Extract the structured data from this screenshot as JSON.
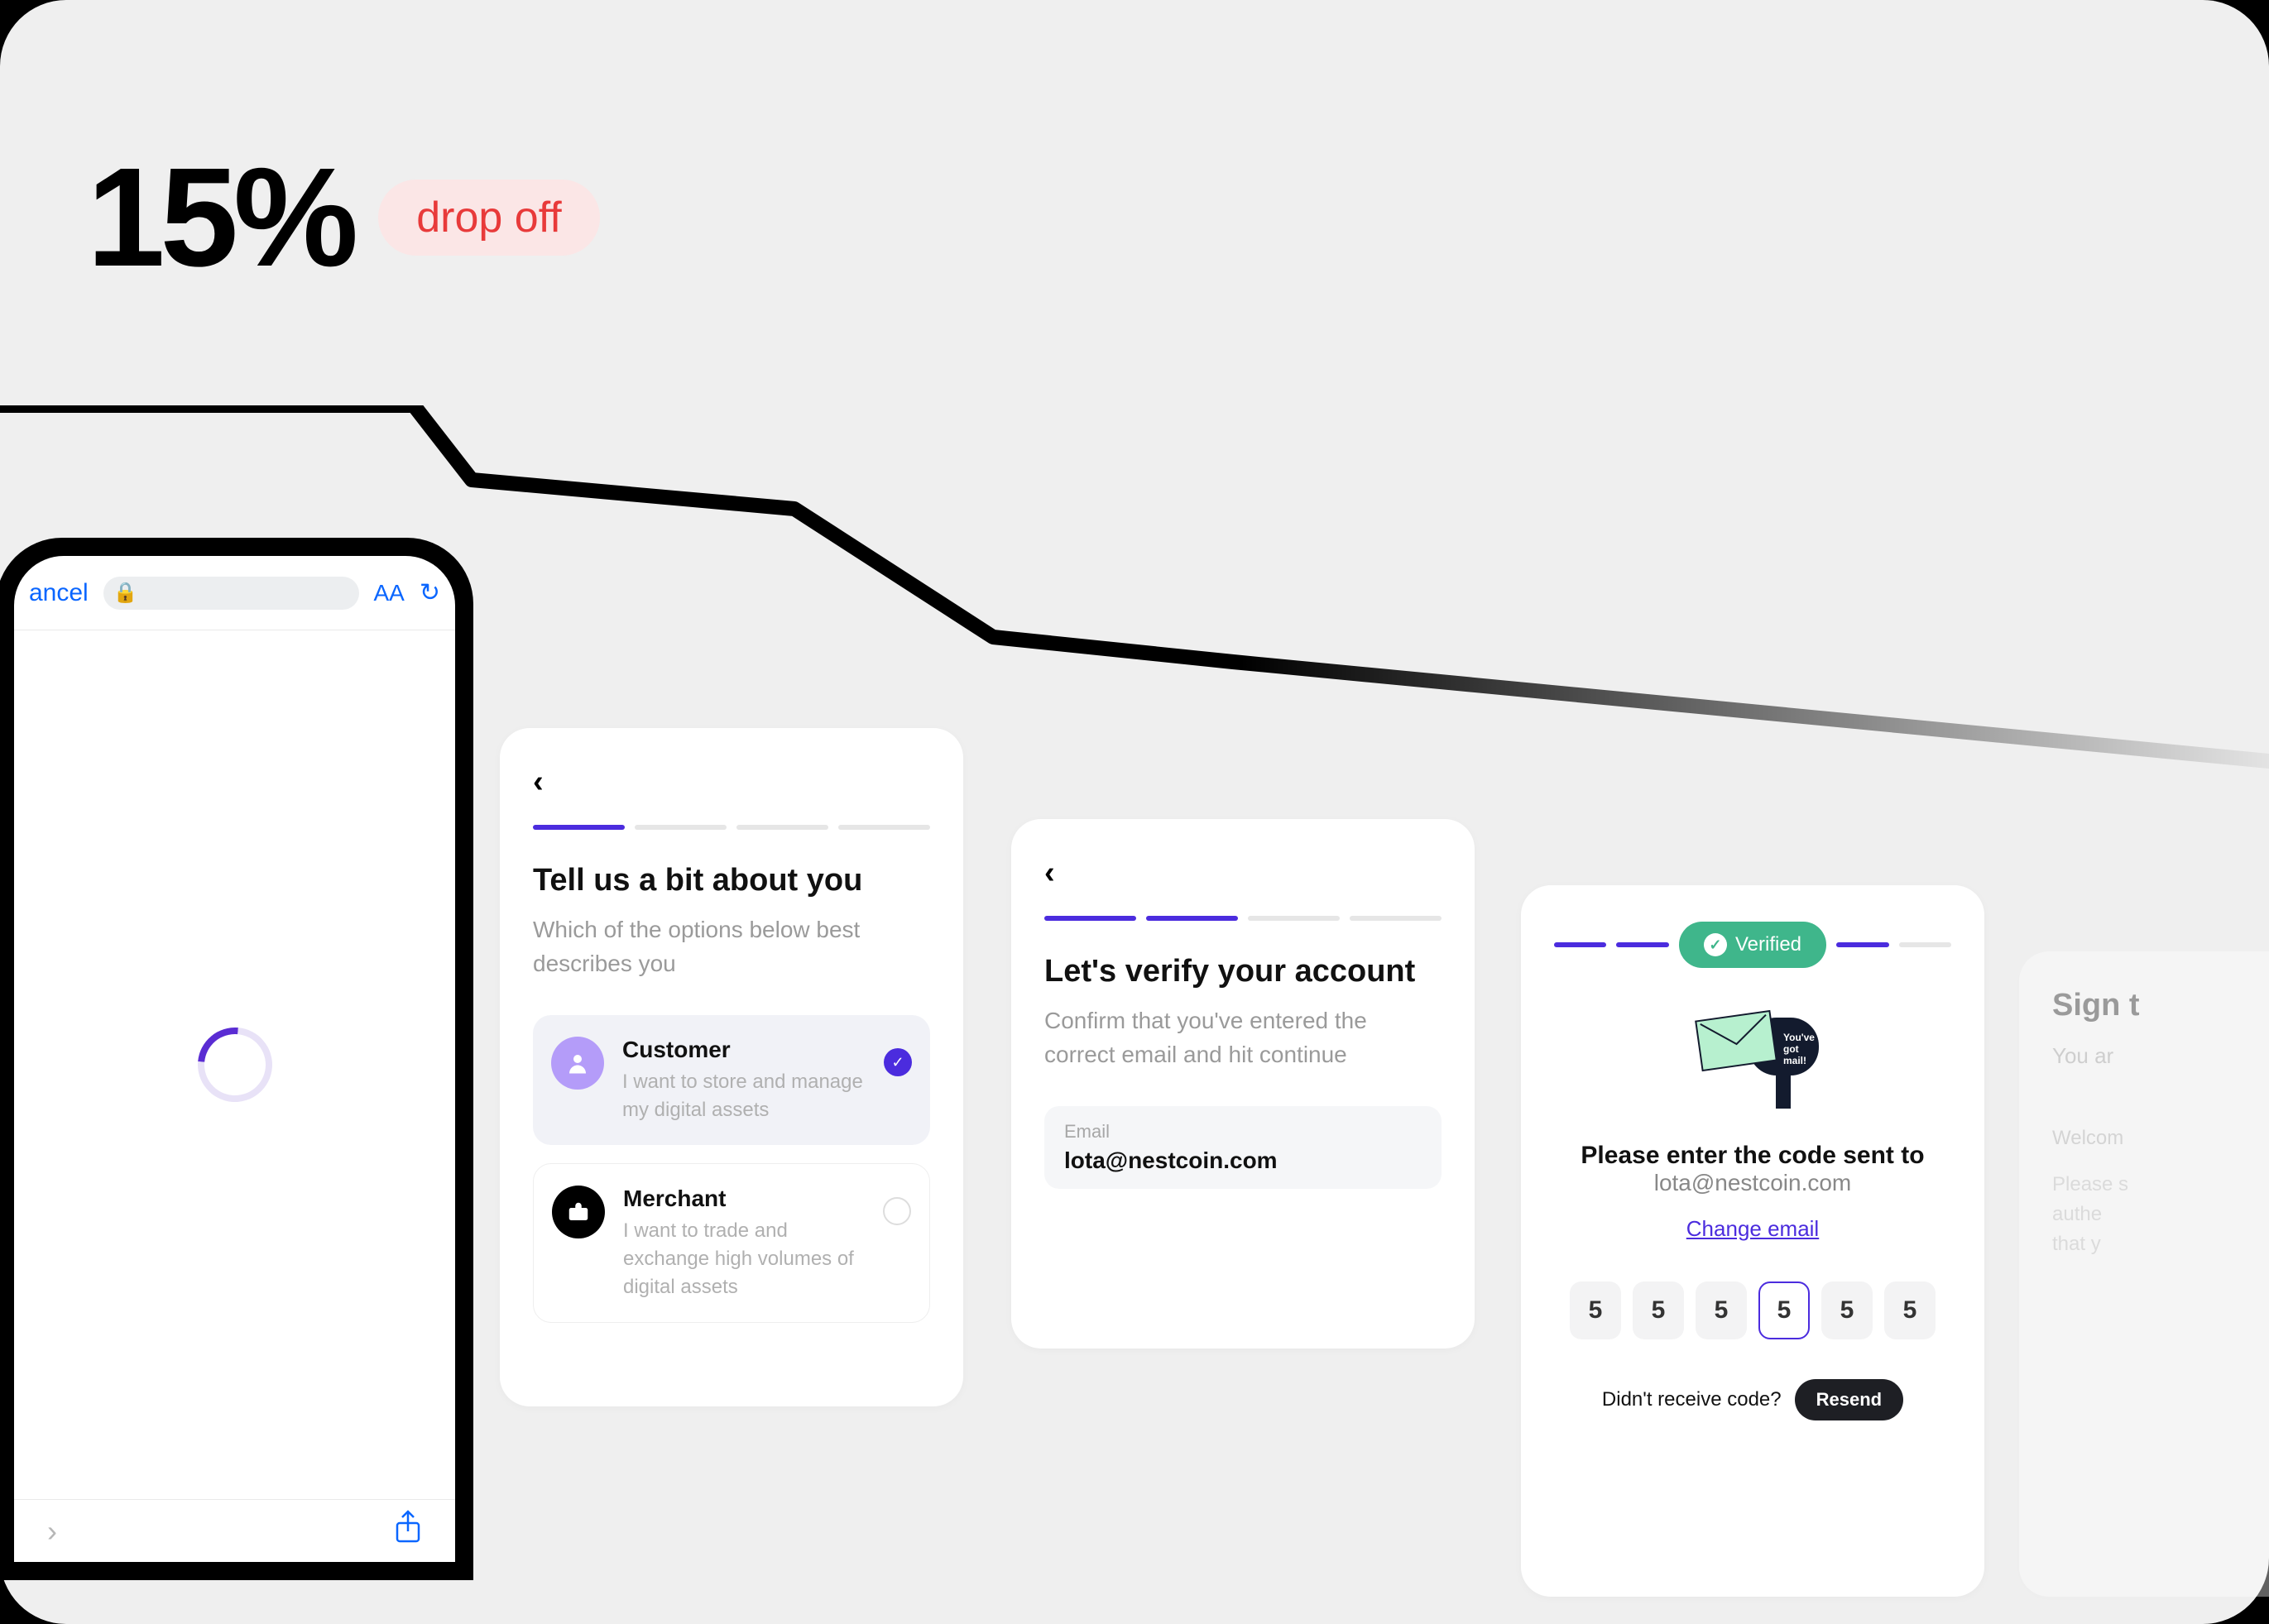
{
  "stat": {
    "value": "15%",
    "label": "drop off"
  },
  "phone": {
    "cancel": "ancel",
    "aa_label": "AA",
    "forward_icon": "›",
    "share_icon": "⇧"
  },
  "card1": {
    "back": "‹",
    "title": "Tell us a bit about you",
    "subtitle": "Which of the options below best describes you",
    "options": [
      {
        "title": "Customer",
        "desc": "I want to store and manage my digital assets",
        "selected": true
      },
      {
        "title": "Merchant",
        "desc": "I want to trade and exchange high volumes of digital assets",
        "selected": false
      }
    ]
  },
  "card2": {
    "back": "‹",
    "title": "Let's verify your account",
    "subtitle": "Confirm that you've entered the correct email and hit continue",
    "email_label": "Email",
    "email_value": "lota@nestcoin.com"
  },
  "card3": {
    "verified_label": "Verified",
    "mail_bubble": "You've\ngot\nmail!",
    "heading": "Please enter the code sent to",
    "email": "lota@nestcoin.com",
    "change_email": "Change email",
    "otp": [
      "5",
      "5",
      "5",
      "5",
      "5",
      "5"
    ],
    "otp_active_index": 3,
    "resend_q": "Didn't receive code?",
    "resend_btn": "Resend"
  },
  "card4": {
    "title": "Sign t",
    "line": "You ar",
    "welcome": "Welcom",
    "help": "Please s",
    "help2": "authe",
    "help3": "that y"
  }
}
